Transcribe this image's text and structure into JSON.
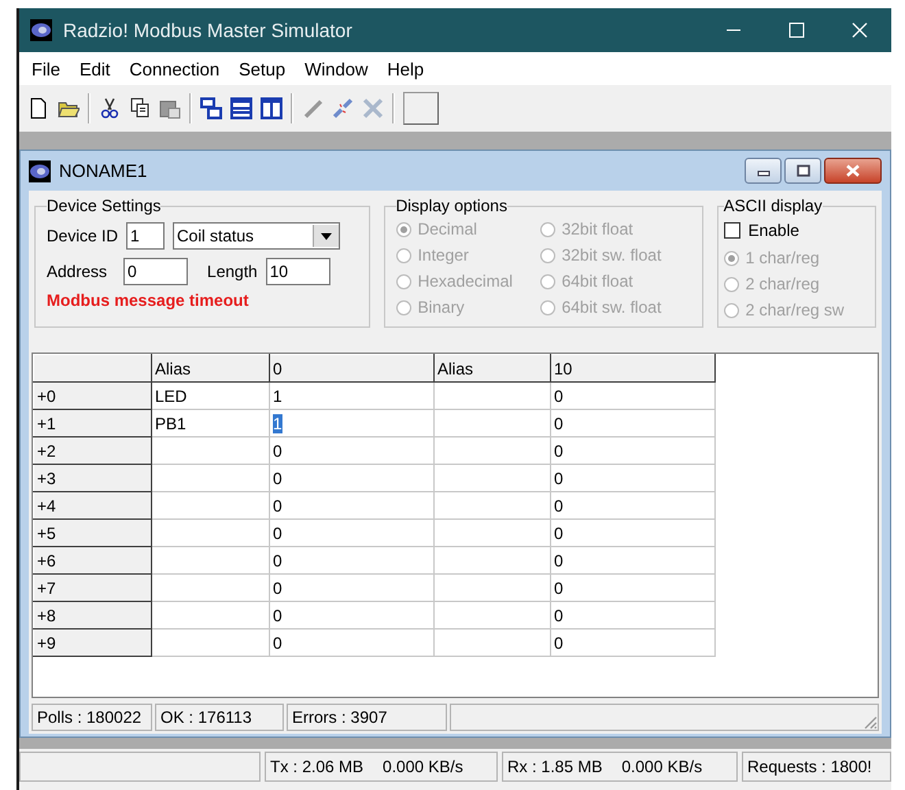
{
  "window": {
    "title": "Radzio! Modbus Master Simulator"
  },
  "menu": [
    "File",
    "Edit",
    "Connection",
    "Setup",
    "Window",
    "Help"
  ],
  "child_window": {
    "title": "NONAME1",
    "device_settings": {
      "title": "Device Settings",
      "device_id_label": "Device ID",
      "device_id": "1",
      "type": "Coil status",
      "address_label": "Address",
      "address": "0",
      "length_label": "Length",
      "length": "10",
      "error": "Modbus message timeout"
    },
    "display_options": {
      "title": "Display options",
      "options": [
        {
          "label": "Decimal",
          "selected": true,
          "disabled": true
        },
        {
          "label": "Integer",
          "selected": false,
          "disabled": true
        },
        {
          "label": "Hexadecimal",
          "selected": false,
          "disabled": true
        },
        {
          "label": "Binary",
          "selected": false,
          "disabled": true
        },
        {
          "label": "32bit float",
          "selected": false,
          "disabled": true
        },
        {
          "label": "32bit sw. float",
          "selected": false,
          "disabled": true
        },
        {
          "label": "64bit float",
          "selected": false,
          "disabled": true
        },
        {
          "label": "64bit sw. float",
          "selected": false,
          "disabled": true
        }
      ]
    },
    "ascii_display": {
      "title": "ASCII display",
      "enable": {
        "label": "Enable",
        "checked": false
      },
      "options": [
        {
          "label": "1 char/reg",
          "selected": true,
          "disabled": true
        },
        {
          "label": "2 char/reg",
          "selected": false,
          "disabled": true
        },
        {
          "label": "2 char/reg sw",
          "selected": false,
          "disabled": true
        }
      ]
    },
    "table": {
      "columns": [
        "Alias",
        "0",
        "Alias",
        "10"
      ],
      "rows": [
        {
          "header": "+0",
          "cells": [
            {
              "text": "LED",
              "selected": false
            },
            {
              "text": "1",
              "selected": false
            },
            {
              "selected": false
            },
            {
              "text": "0",
              "selected": false
            }
          ]
        },
        {
          "header": "+1",
          "cells": [
            {
              "text": "PB1",
              "selected": false
            },
            {
              "text": "1",
              "selected": true
            },
            {
              "selected": false
            },
            {
              "text": "0",
              "selected": false
            }
          ]
        },
        {
          "header": "+2",
          "cells": [
            {
              "selected": false
            },
            {
              "text": "0",
              "selected": false
            },
            {
              "selected": false
            },
            {
              "text": "0",
              "selected": false
            }
          ]
        },
        {
          "header": "+3",
          "cells": [
            {
              "selected": false
            },
            {
              "text": "0",
              "selected": false
            },
            {
              "selected": false
            },
            {
              "text": "0",
              "selected": false
            }
          ]
        },
        {
          "header": "+4",
          "cells": [
            {
              "selected": false
            },
            {
              "text": "0",
              "selected": false
            },
            {
              "selected": false
            },
            {
              "text": "0",
              "selected": false
            }
          ]
        },
        {
          "header": "+5",
          "cells": [
            {
              "selected": false
            },
            {
              "text": "0",
              "selected": false
            },
            {
              "selected": false
            },
            {
              "text": "0",
              "selected": false
            }
          ]
        },
        {
          "header": "+6",
          "cells": [
            {
              "selected": false
            },
            {
              "text": "0",
              "selected": false
            },
            {
              "selected": false
            },
            {
              "text": "0",
              "selected": false
            }
          ]
        },
        {
          "header": "+7",
          "cells": [
            {
              "selected": false
            },
            {
              "text": "0",
              "selected": false
            },
            {
              "selected": false
            },
            {
              "text": "0",
              "selected": false
            }
          ]
        },
        {
          "header": "+8",
          "cells": [
            {
              "selected": false
            },
            {
              "text": "0",
              "selected": false
            },
            {
              "selected": false
            },
            {
              "text": "0",
              "selected": false
            }
          ]
        },
        {
          "header": "+9",
          "cells": [
            {
              "selected": false
            },
            {
              "text": "0",
              "selected": false
            },
            {
              "selected": false
            },
            {
              "text": "0",
              "selected": false
            }
          ]
        }
      ]
    },
    "status_bar": [
      "Polls : 180022",
      "OK : 176113",
      "Errors : 3907"
    ]
  },
  "status_bar": {
    "tx": "Tx : 2.06 MB",
    "tx_rate": "0.000 KB/s",
    "rx": "Rx : 1.85 MB",
    "rx_rate": "0.000 KB/s",
    "requests": "Requests : 1800!"
  }
}
